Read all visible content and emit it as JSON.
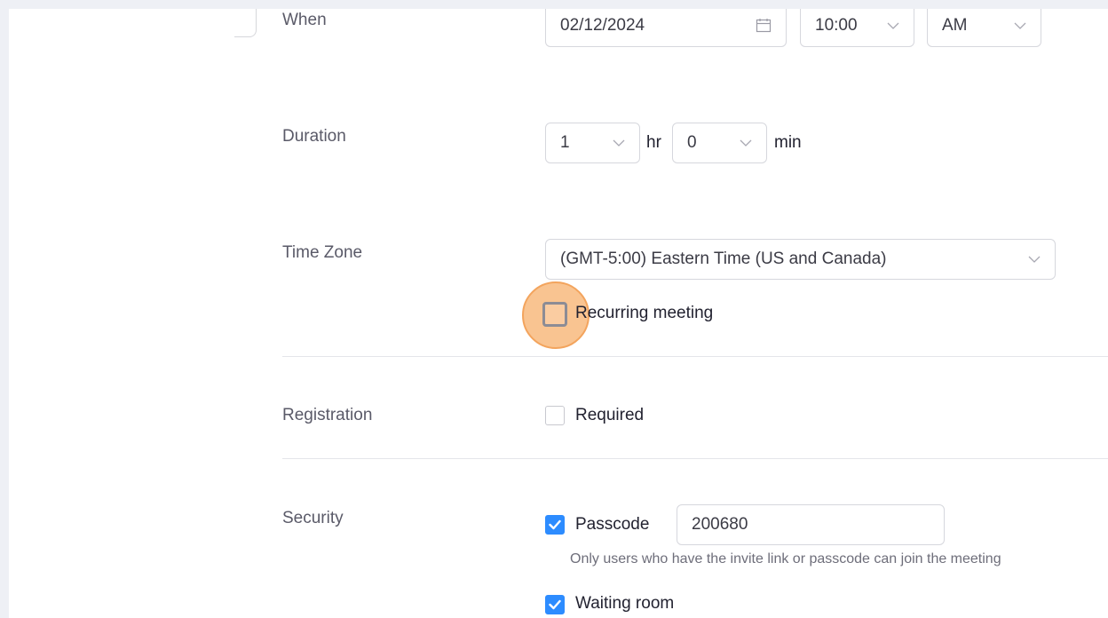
{
  "form": {
    "when": {
      "label": "When",
      "date": "02/12/2024",
      "hour": "10:00",
      "ampm": "AM"
    },
    "duration": {
      "label": "Duration",
      "hours": "1",
      "hours_unit": "hr",
      "minutes": "0",
      "minutes_unit": "min"
    },
    "timezone": {
      "label": "Time Zone",
      "value": "(GMT-5:00) Eastern Time (US and Canada)",
      "recurring_label": "Recurring meeting"
    },
    "registration": {
      "label": "Registration",
      "required_label": "Required"
    },
    "security": {
      "label": "Security",
      "passcode_label": "Passcode",
      "passcode_value": "200680",
      "passcode_hint": "Only users who have the invite link or passcode can join the meeting",
      "waiting_room_label": "Waiting room"
    }
  },
  "colors": {
    "accent": "#2d8cff",
    "highlight": "#f3a45d"
  },
  "icons": {
    "calendar": "calendar-icon",
    "dropdown": "chevron-down-icon",
    "check": "check-icon"
  }
}
